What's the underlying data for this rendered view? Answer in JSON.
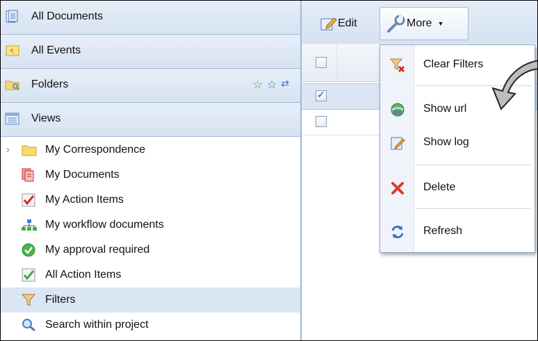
{
  "left_panel": {
    "accordion": [
      {
        "label": "All Documents",
        "icon": "documents-icon"
      },
      {
        "label": "All Events",
        "icon": "events-icon"
      },
      {
        "label": "Folders",
        "icon": "folders-icon"
      },
      {
        "label": "Views",
        "icon": "views-icon"
      }
    ],
    "folder_actions": {
      "star_green": "☆",
      "star_blue": "☆",
      "refresh": "⇄"
    },
    "views_tree": [
      {
        "label": "My Correspondence",
        "icon": "folder-icon"
      },
      {
        "label": "My Documents",
        "icon": "documents-icon"
      },
      {
        "label": "My Action Items",
        "icon": "checkmark-icon"
      },
      {
        "label": "My workflow documents",
        "icon": "workflow-icon"
      },
      {
        "label": "My approval required",
        "icon": "approval-icon"
      },
      {
        "label": "All Action Items",
        "icon": "checkmark-icon"
      },
      {
        "label": "Filters",
        "icon": "filter-icon"
      },
      {
        "label": "Search within project",
        "icon": "search-icon"
      }
    ]
  },
  "toolbar": {
    "edit_label": "Edit",
    "more_label": "More",
    "more_caret": "▼"
  },
  "more_menu": {
    "items": [
      {
        "label": "Clear Filters",
        "icon": "clear-filter-icon"
      },
      {
        "label": "Show url",
        "icon": "globe-icon"
      },
      {
        "label": "Show log",
        "icon": "log-icon"
      },
      {
        "label": "Delete",
        "icon": "delete-icon"
      },
      {
        "label": "Refresh",
        "icon": "refresh-icon"
      }
    ]
  },
  "grid": {
    "rows": [
      {
        "checked": false
      },
      {
        "checked": true
      },
      {
        "checked": false
      }
    ],
    "check_mark": "✓"
  },
  "colors": {
    "accent": "#9fb9d8",
    "selected_row": "#dbe6f5",
    "delete_red": "#e03a2c"
  }
}
